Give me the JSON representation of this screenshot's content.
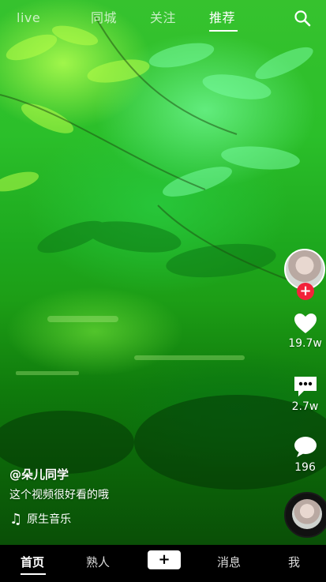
{
  "top_nav": {
    "tabs": [
      {
        "label": "live"
      },
      {
        "label": "同城"
      },
      {
        "label": "关注"
      },
      {
        "label": "推荐"
      }
    ],
    "active_tab": "推荐",
    "search_icon": "search-icon"
  },
  "side": {
    "follow_symbol": "+",
    "like_count": "19.7w",
    "comment_count": "2.7w",
    "share_count": "196",
    "icons": {
      "like": "heart-icon",
      "comment": "comment-icon",
      "share": "share-bubble-icon",
      "music_disc": "music-disc-icon"
    }
  },
  "video": {
    "author": "@朵儿同学",
    "description": "这个视频很好看的哦",
    "music": "原生音乐"
  },
  "bottom_nav": {
    "home": "首页",
    "friends": "熟人",
    "create": "+",
    "messages": "消息",
    "me": "我"
  },
  "colors": {
    "accent_red": "#f2223a",
    "video_green": "#2bbf2a",
    "tabbar_bg": "#000000"
  }
}
